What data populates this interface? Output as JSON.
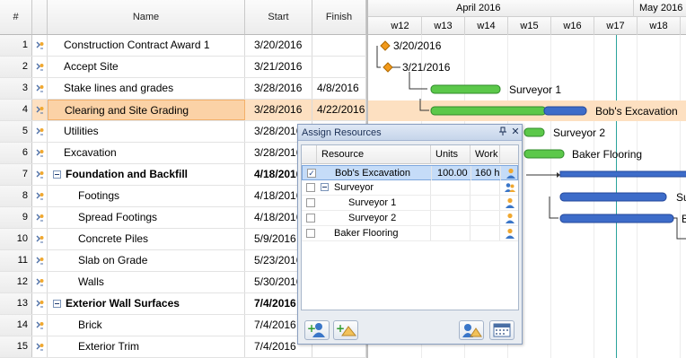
{
  "columns": {
    "num": "#",
    "name": "Name",
    "start": "Start",
    "finish": "Finish"
  },
  "tasks": [
    {
      "num": "1",
      "name": "Construction Contract Award 1",
      "start": "3/20/2016",
      "finish": "",
      "bold": false,
      "summary": false
    },
    {
      "num": "2",
      "name": "Accept Site",
      "start": "3/21/2016",
      "finish": "",
      "bold": false,
      "summary": false
    },
    {
      "num": "3",
      "name": "Stake lines and grades",
      "start": "3/28/2016",
      "finish": "4/8/2016",
      "bold": false,
      "summary": false
    },
    {
      "num": "4",
      "name": "Clearing and Site Grading",
      "start": "3/28/2016",
      "finish": "4/22/2016",
      "bold": false,
      "summary": false
    },
    {
      "num": "5",
      "name": "Utilities",
      "start": "3/28/2016",
      "finish": "",
      "bold": false,
      "summary": false
    },
    {
      "num": "6",
      "name": "Excavation",
      "start": "3/28/2016",
      "finish": "",
      "bold": false,
      "summary": false
    },
    {
      "num": "7",
      "name": "Foundation and Backfill",
      "start": "4/18/2016",
      "finish": "",
      "bold": true,
      "summary": true
    },
    {
      "num": "8",
      "name": "Footings",
      "start": "4/18/2016",
      "finish": "",
      "bold": false,
      "summary": false
    },
    {
      "num": "9",
      "name": "Spread Footings",
      "start": "4/18/2016",
      "finish": "",
      "bold": false,
      "summary": false
    },
    {
      "num": "10",
      "name": "Concrete Piles",
      "start": "5/9/2016",
      "finish": "",
      "bold": false,
      "summary": false
    },
    {
      "num": "11",
      "name": "Slab on Grade",
      "start": "5/23/2016",
      "finish": "",
      "bold": false,
      "summary": false
    },
    {
      "num": "12",
      "name": "Walls",
      "start": "5/30/2016",
      "finish": "",
      "bold": false,
      "summary": false
    },
    {
      "num": "13",
      "name": "Exterior Wall Surfaces",
      "start": "7/4/2016",
      "finish": "",
      "bold": true,
      "summary": true
    },
    {
      "num": "14",
      "name": "Brick",
      "start": "7/4/2016",
      "finish": "",
      "bold": false,
      "summary": false
    },
    {
      "num": "15",
      "name": "Exterior Trim",
      "start": "7/4/2016",
      "finish": "",
      "bold": false,
      "summary": false
    }
  ],
  "timeline": {
    "months": [
      "April 2016",
      "May 2016"
    ],
    "weeks": [
      "w12",
      "w13",
      "w14",
      "w15",
      "w16",
      "w17",
      "w18"
    ]
  },
  "chart_labels": {
    "m1": "3/20/2016",
    "m2": "3/21/2016",
    "r3": "Surveyor 1",
    "r4": "Bob's Excavation",
    "r5": "Surveyor 2",
    "r6": "Baker Flooring",
    "r8": "Su",
    "r9": "B"
  },
  "dialog": {
    "title": "Assign Resources",
    "pin": "∂",
    "close": "✕",
    "headers": {
      "resource": "Resource",
      "units": "Units",
      "work": "Work"
    },
    "rows": [
      {
        "name": "Bob's Excavation",
        "units": "100.00",
        "work": "160 h",
        "checked": true
      },
      {
        "name": "Surveyor",
        "units": "",
        "work": "",
        "checked": false
      },
      {
        "name": "Surveyor 1",
        "units": "",
        "work": "",
        "checked": false
      },
      {
        "name": "Surveyor 2",
        "units": "",
        "work": "",
        "checked": false
      },
      {
        "name": "Baker Flooring",
        "units": "",
        "work": "",
        "checked": false
      }
    ]
  },
  "colors": {
    "green_bar": "#5cc84a",
    "blue_bar": "#3d6cc9",
    "milestone": "#f29a1c",
    "selected_row": "#fde0c1",
    "today_line": "#2aa39b"
  }
}
